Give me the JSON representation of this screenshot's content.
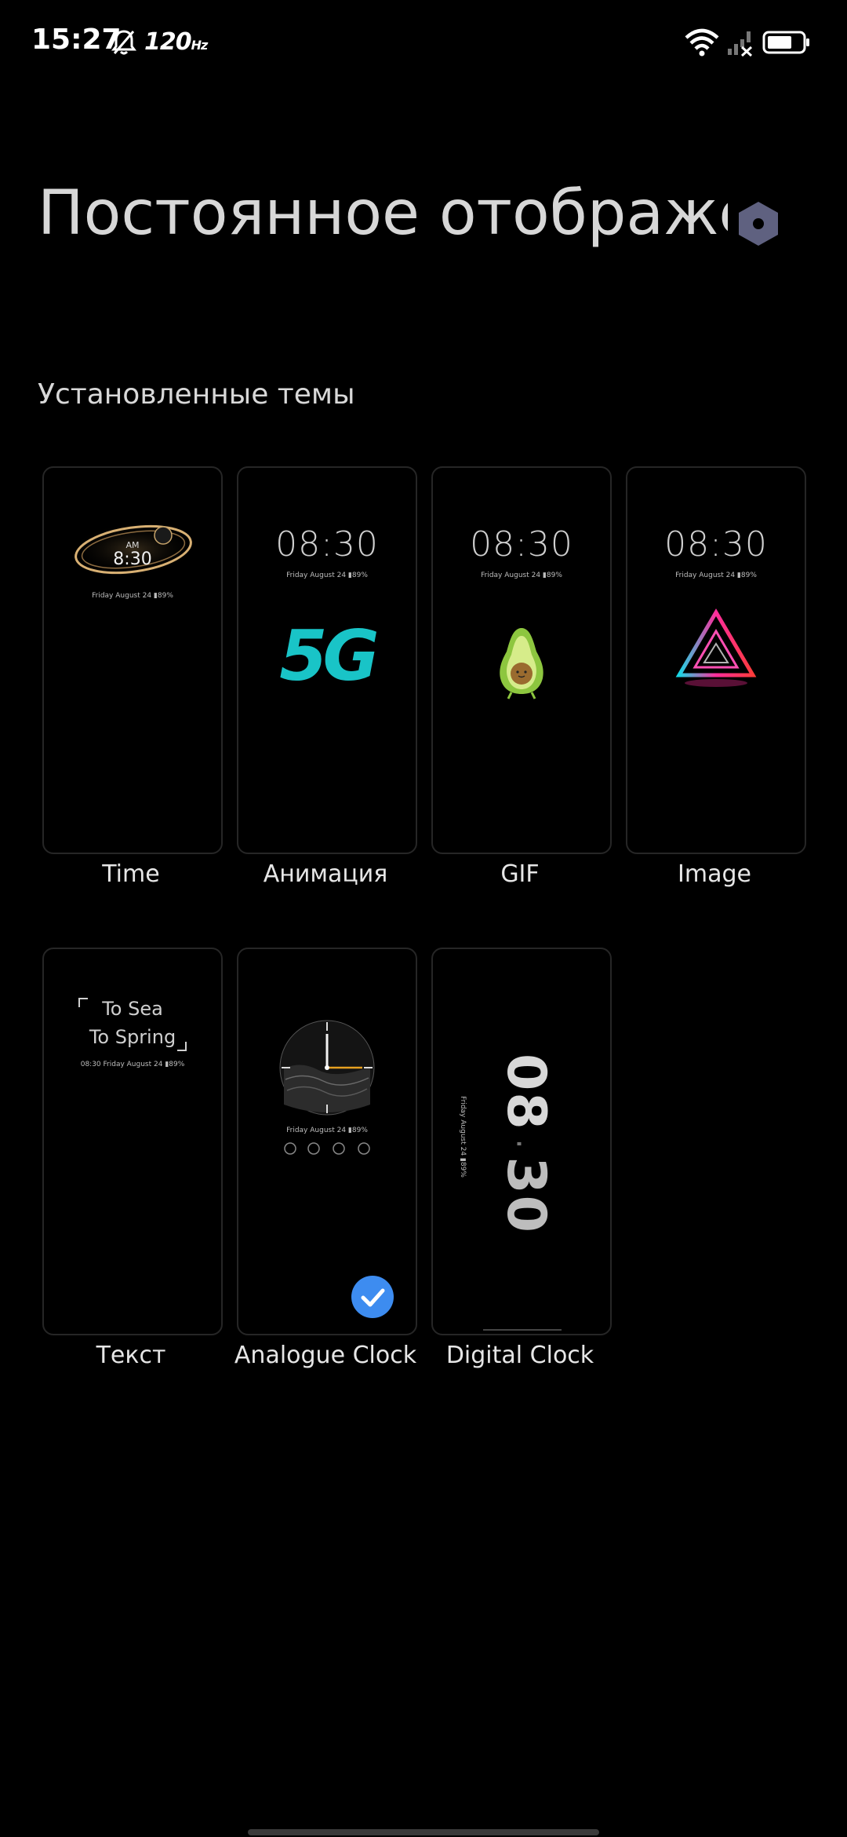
{
  "status_bar": {
    "time": "15:27",
    "refresh_rate": "120",
    "refresh_unit": "Hz",
    "icons": [
      "bell-muted-icon",
      "wifi-icon",
      "cellular-no-signal-icon",
      "battery-icon"
    ]
  },
  "header": {
    "title": "Постоянное отображение",
    "settings_icon": "gear-hexagon-icon"
  },
  "section": {
    "heading": "Установленные темы"
  },
  "themes": [
    {
      "label": "Time",
      "preview": {
        "am": "AM",
        "time": "8:30",
        "date": "Friday  August 24  ▮89%"
      },
      "selected": false
    },
    {
      "label": "Анимация",
      "preview": {
        "time": "08:30",
        "date": "Friday  August 24  ▮89%",
        "graphic": "5G"
      },
      "selected": false
    },
    {
      "label": "GIF",
      "preview": {
        "time": "08:30",
        "date": "Friday  August 24  ▮89%",
        "graphic": "avocado-icon"
      },
      "selected": false
    },
    {
      "label": "Image",
      "preview": {
        "time": "08:30",
        "date": "Friday  August 24  ▮89%",
        "graphic": "neon-triangle-icon"
      },
      "selected": false
    },
    {
      "label": "Текст",
      "preview": {
        "line1": "To Sea",
        "line2": "To Spring",
        "date": "08:30  Friday  August 24  ▮89%"
      },
      "selected": false
    },
    {
      "label": "Analogue Clock",
      "preview": {
        "date": "Friday  August 24  ▮89%",
        "graphic": "analogue-clock-icon"
      },
      "selected": true
    },
    {
      "label": "Digital Clock",
      "preview": {
        "hours": "08",
        "minutes": "30",
        "date": "Friday  August 24  ▮89%"
      },
      "selected": false
    }
  ],
  "colors": {
    "background": "#000000",
    "title": "#d7d7d7",
    "accent_check": "#3d8cf0",
    "gear": "#5f6180"
  }
}
